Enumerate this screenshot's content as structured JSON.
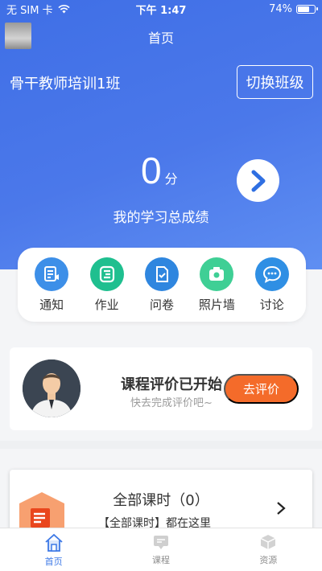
{
  "status_bar": {
    "carrier": "无 SIM 卡",
    "time": "下午 1:47",
    "battery": "74%",
    "battery_level": 0.74
  },
  "nav": {
    "title": "首页"
  },
  "header": {
    "class_name": "骨干教师培训1班",
    "switch_label": "切换班级"
  },
  "score": {
    "value": "0",
    "unit": "分",
    "label": "我的学习总成绩"
  },
  "quick_actions": [
    {
      "label": "通知",
      "icon": "notice-icon",
      "color": "#3d8fe8"
    },
    {
      "label": "作业",
      "icon": "homework-icon",
      "color": "#1fbf8f"
    },
    {
      "label": "问卷",
      "icon": "survey-icon",
      "color": "#2f86df"
    },
    {
      "label": "照片墙",
      "icon": "camera-icon",
      "color": "#3fcf95"
    },
    {
      "label": "讨论",
      "icon": "discussion-icon",
      "color": "#2f8fe4"
    }
  ],
  "evaluation": {
    "title": "课程评价已开始",
    "subtitle": "快去完成评价吧~",
    "button": "去评价"
  },
  "course": {
    "title": "全部课时（0）",
    "subtitle": "【全部课时】都在这里"
  },
  "tabs": [
    {
      "label": "首页",
      "icon": "home-icon",
      "active": true
    },
    {
      "label": "课程",
      "icon": "course-icon",
      "active": false
    },
    {
      "label": "资源",
      "icon": "resource-icon",
      "active": false
    }
  ],
  "colors": {
    "primary": "#4a78ea",
    "accent_orange": "#f46b2a",
    "tab_active": "#3c78e6"
  }
}
